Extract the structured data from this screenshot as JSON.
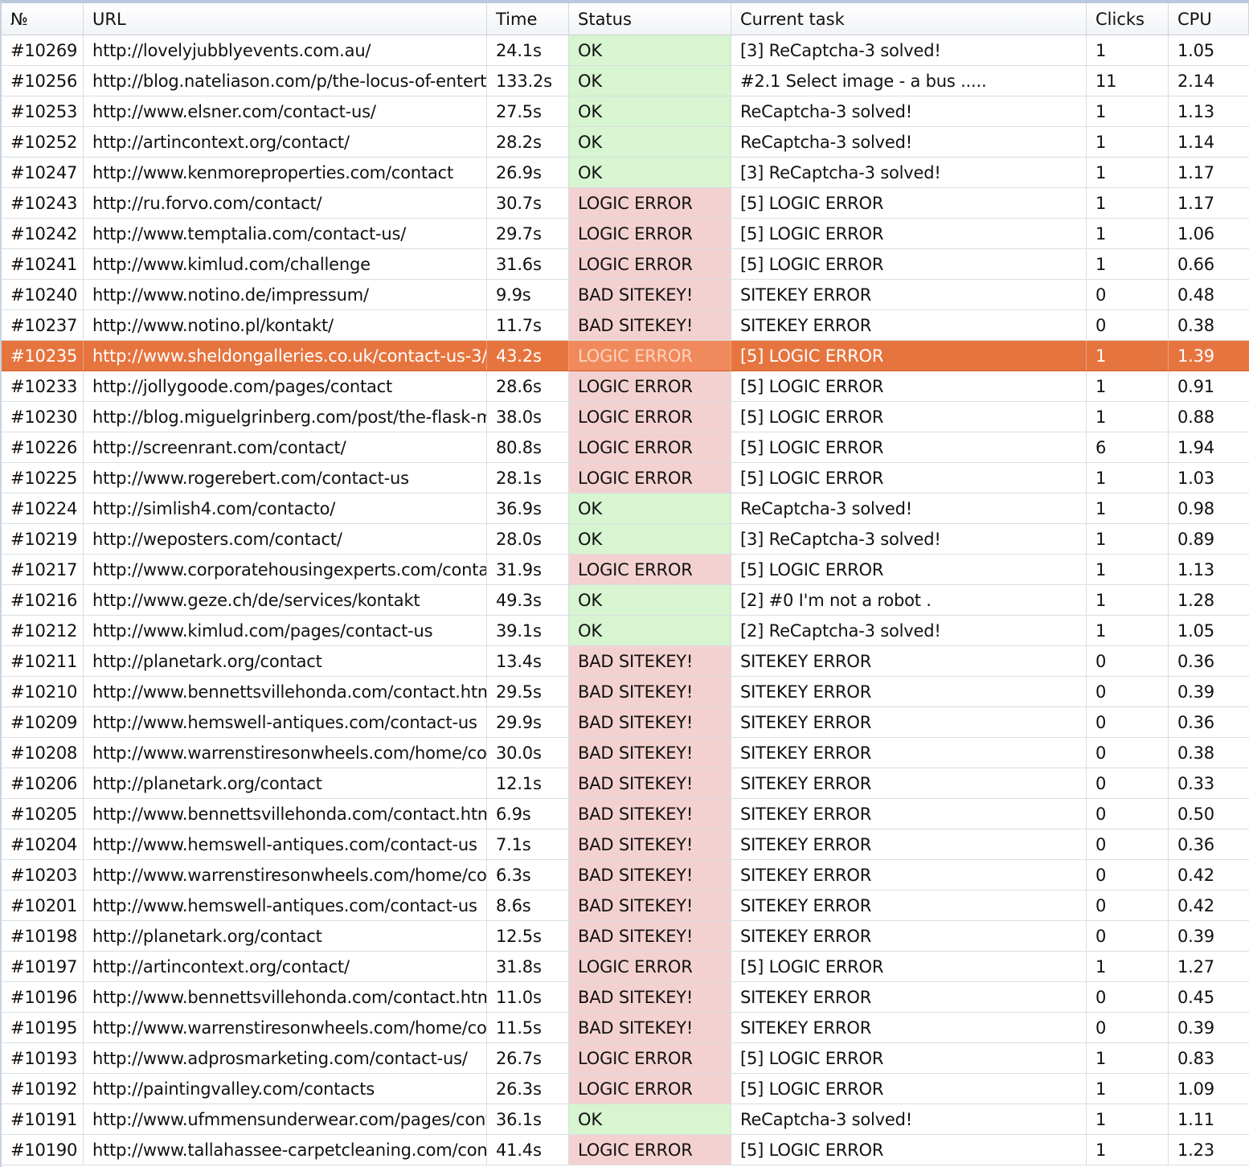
{
  "columns": [
    "№",
    "URL",
    "Time",
    "Status",
    "Current task",
    "Clicks",
    "CPU"
  ],
  "status_colors": {
    "OK": "#d6f5d0",
    "LOGIC ERROR": "#f4d1d1",
    "BAD SITEKEY!": "#f4d1d1",
    "selected_row": "#e6743f"
  },
  "selected_id": "#10235",
  "rows": [
    {
      "id": "#10269",
      "url": "http://lovelyjubblyevents.com.au/",
      "time": "24.1s",
      "status": "OK",
      "task": "[3] ReCaptcha-3 solved!",
      "clicks": "1",
      "cpu": "1.05"
    },
    {
      "id": "#10256",
      "url": "http://blog.nateliason.com/p/the-locus-of-entertair",
      "time": "133.2s",
      "status": "OK",
      "task": "#2.1 Select image - a bus .....",
      "clicks": "11",
      "cpu": "2.14"
    },
    {
      "id": "#10253",
      "url": "http://www.elsner.com/contact-us/",
      "time": "27.5s",
      "status": "OK",
      "task": "ReCaptcha-3 solved!",
      "clicks": "1",
      "cpu": "1.13"
    },
    {
      "id": "#10252",
      "url": "http://artincontext.org/contact/",
      "time": "28.2s",
      "status": "OK",
      "task": "ReCaptcha-3 solved!",
      "clicks": "1",
      "cpu": "1.14"
    },
    {
      "id": "#10247",
      "url": "http://www.kenmoreproperties.com/contact",
      "time": "26.9s",
      "status": "OK",
      "task": "[3] ReCaptcha-3 solved!",
      "clicks": "1",
      "cpu": "1.17"
    },
    {
      "id": "#10243",
      "url": "http://ru.forvo.com/contact/",
      "time": "30.7s",
      "status": "LOGIC ERROR",
      "task": "[5] LOGIC ERROR",
      "clicks": "1",
      "cpu": "1.17"
    },
    {
      "id": "#10242",
      "url": "http://www.temptalia.com/contact-us/",
      "time": "29.7s",
      "status": "LOGIC ERROR",
      "task": "[5] LOGIC ERROR",
      "clicks": "1",
      "cpu": "1.06"
    },
    {
      "id": "#10241",
      "url": "http://www.kimlud.com/challenge",
      "time": "31.6s",
      "status": "LOGIC ERROR",
      "task": "[5] LOGIC ERROR",
      "clicks": "1",
      "cpu": "0.66"
    },
    {
      "id": "#10240",
      "url": "http://www.notino.de/impressum/",
      "time": "9.9s",
      "status": "BAD SITEKEY!",
      "task": "SITEKEY ERROR",
      "clicks": "0",
      "cpu": "0.48"
    },
    {
      "id": "#10237",
      "url": "http://www.notino.pl/kontakt/",
      "time": "11.7s",
      "status": "BAD SITEKEY!",
      "task": "SITEKEY ERROR",
      "clicks": "0",
      "cpu": "0.38"
    },
    {
      "id": "#10235",
      "url": "http://www.sheldongalleries.co.uk/contact-us-3/",
      "time": "43.2s",
      "status": "LOGIC ERROR",
      "task": "[5] LOGIC ERROR",
      "clicks": "1",
      "cpu": "1.39"
    },
    {
      "id": "#10233",
      "url": "http://jollygoode.com/pages/contact",
      "time": "28.6s",
      "status": "LOGIC ERROR",
      "task": "[5] LOGIC ERROR",
      "clicks": "1",
      "cpu": "0.91"
    },
    {
      "id": "#10230",
      "url": "http://blog.miguelgrinberg.com/post/the-flask-meg",
      "time": "38.0s",
      "status": "LOGIC ERROR",
      "task": "[5] LOGIC ERROR",
      "clicks": "1",
      "cpu": "0.88"
    },
    {
      "id": "#10226",
      "url": "http://screenrant.com/contact/",
      "time": "80.8s",
      "status": "LOGIC ERROR",
      "task": "[5] LOGIC ERROR",
      "clicks": "6",
      "cpu": "1.94"
    },
    {
      "id": "#10225",
      "url": "http://www.rogerebert.com/contact-us",
      "time": "28.1s",
      "status": "LOGIC ERROR",
      "task": "[5] LOGIC ERROR",
      "clicks": "1",
      "cpu": "1.03"
    },
    {
      "id": "#10224",
      "url": "http://simlish4.com/contacto/",
      "time": "36.9s",
      "status": "OK",
      "task": "ReCaptcha-3 solved!",
      "clicks": "1",
      "cpu": "0.98"
    },
    {
      "id": "#10219",
      "url": "http://weposters.com/contact/",
      "time": "28.0s",
      "status": "OK",
      "task": "[3] ReCaptcha-3 solved!",
      "clicks": "1",
      "cpu": "0.89"
    },
    {
      "id": "#10217",
      "url": "http://www.corporatehousingexperts.com/contact",
      "time": "31.9s",
      "status": "LOGIC ERROR",
      "task": "[5] LOGIC ERROR",
      "clicks": "1",
      "cpu": "1.13"
    },
    {
      "id": "#10216",
      "url": "http://www.geze.ch/de/services/kontakt",
      "time": "49.3s",
      "status": "OK",
      "task": "[2] #0  I'm not a robot .",
      "clicks": "1",
      "cpu": "1.28"
    },
    {
      "id": "#10212",
      "url": "http://www.kimlud.com/pages/contact-us",
      "time": "39.1s",
      "status": "OK",
      "task": "[2] ReCaptcha-3 solved!",
      "clicks": "1",
      "cpu": "1.05"
    },
    {
      "id": "#10211",
      "url": "http://planetark.org/contact",
      "time": "13.4s",
      "status": "BAD SITEKEY!",
      "task": "SITEKEY ERROR",
      "clicks": "0",
      "cpu": "0.36"
    },
    {
      "id": "#10210",
      "url": "http://www.bennettsvillehonda.com/contact.htm",
      "time": "29.5s",
      "status": "BAD SITEKEY!",
      "task": "SITEKEY ERROR",
      "clicks": "0",
      "cpu": "0.39"
    },
    {
      "id": "#10209",
      "url": "http://www.hemswell-antiques.com/contact-us",
      "time": "29.9s",
      "status": "BAD SITEKEY!",
      "task": "SITEKEY ERROR",
      "clicks": "0",
      "cpu": "0.36"
    },
    {
      "id": "#10208",
      "url": "http://www.warrenstiresonwheels.com/home/conta",
      "time": "30.0s",
      "status": "BAD SITEKEY!",
      "task": "SITEKEY ERROR",
      "clicks": "0",
      "cpu": "0.38"
    },
    {
      "id": "#10206",
      "url": "http://planetark.org/contact",
      "time": "12.1s",
      "status": "BAD SITEKEY!",
      "task": "SITEKEY ERROR",
      "clicks": "0",
      "cpu": "0.33"
    },
    {
      "id": "#10205",
      "url": "http://www.bennettsvillehonda.com/contact.htm",
      "time": "6.9s",
      "status": "BAD SITEKEY!",
      "task": "SITEKEY ERROR",
      "clicks": "0",
      "cpu": "0.50"
    },
    {
      "id": "#10204",
      "url": "http://www.hemswell-antiques.com/contact-us",
      "time": "7.1s",
      "status": "BAD SITEKEY!",
      "task": "SITEKEY ERROR",
      "clicks": "0",
      "cpu": "0.36"
    },
    {
      "id": "#10203",
      "url": "http://www.warrenstiresonwheels.com/home/conta",
      "time": "6.3s",
      "status": "BAD SITEKEY!",
      "task": "SITEKEY ERROR",
      "clicks": "0",
      "cpu": "0.42"
    },
    {
      "id": "#10201",
      "url": "http://www.hemswell-antiques.com/contact-us",
      "time": "8.6s",
      "status": "BAD SITEKEY!",
      "task": "SITEKEY ERROR",
      "clicks": "0",
      "cpu": "0.42"
    },
    {
      "id": "#10198",
      "url": "http://planetark.org/contact",
      "time": "12.5s",
      "status": "BAD SITEKEY!",
      "task": "SITEKEY ERROR",
      "clicks": "0",
      "cpu": "0.39"
    },
    {
      "id": "#10197",
      "url": "http://artincontext.org/contact/",
      "time": "31.8s",
      "status": "LOGIC ERROR",
      "task": "[5] LOGIC ERROR",
      "clicks": "1",
      "cpu": "1.27"
    },
    {
      "id": "#10196",
      "url": "http://www.bennettsvillehonda.com/contact.htm",
      "time": "11.0s",
      "status": "BAD SITEKEY!",
      "task": "SITEKEY ERROR",
      "clicks": "0",
      "cpu": "0.45"
    },
    {
      "id": "#10195",
      "url": "http://www.warrenstiresonwheels.com/home/conta",
      "time": "11.5s",
      "status": "BAD SITEKEY!",
      "task": "SITEKEY ERROR",
      "clicks": "0",
      "cpu": "0.39"
    },
    {
      "id": "#10193",
      "url": "http://www.adprosmarketing.com/contact-us/",
      "time": "26.7s",
      "status": "LOGIC ERROR",
      "task": "[5] LOGIC ERROR",
      "clicks": "1",
      "cpu": "0.83"
    },
    {
      "id": "#10192",
      "url": "http://paintingvalley.com/contacts",
      "time": "26.3s",
      "status": "LOGIC ERROR",
      "task": "[5] LOGIC ERROR",
      "clicks": "1",
      "cpu": "1.09"
    },
    {
      "id": "#10191",
      "url": "http://www.ufmmensunderwear.com/pages/contac",
      "time": "36.1s",
      "status": "OK",
      "task": "ReCaptcha-3 solved!",
      "clicks": "1",
      "cpu": "1.11"
    },
    {
      "id": "#10190",
      "url": "http://www.tallahassee-carpetcleaning.com/contac",
      "time": "41.4s",
      "status": "LOGIC ERROR",
      "task": "[5] LOGIC ERROR",
      "clicks": "1",
      "cpu": "1.23"
    }
  ]
}
